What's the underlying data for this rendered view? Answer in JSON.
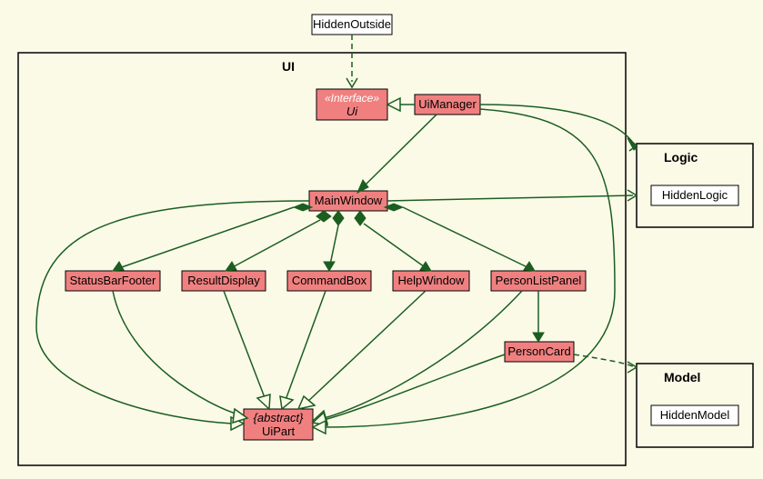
{
  "packages": {
    "ui": {
      "label": "UI"
    },
    "logic": {
      "label": "Logic"
    },
    "model": {
      "label": "Model"
    }
  },
  "nodes": {
    "hiddenOutside": {
      "label": "HiddenOutside"
    },
    "ui_iface": {
      "stereotype": "«Interface»",
      "name": "Ui"
    },
    "uiManager": {
      "label": "UiManager"
    },
    "mainWindow": {
      "label": "MainWindow"
    },
    "statusBarFooter": {
      "label": "StatusBarFooter"
    },
    "resultDisplay": {
      "label": "ResultDisplay"
    },
    "commandBox": {
      "label": "CommandBox"
    },
    "helpWindow": {
      "label": "HelpWindow"
    },
    "personListPanel": {
      "label": "PersonListPanel"
    },
    "personCard": {
      "label": "PersonCard"
    },
    "uiPart": {
      "stereotype": "{abstract}",
      "name": "UiPart"
    },
    "hiddenLogic": {
      "label": "HiddenLogic"
    },
    "hiddenModel": {
      "label": "HiddenModel"
    }
  },
  "relations": [
    {
      "from": "HiddenOutside",
      "to": "Ui",
      "type": "dependency"
    },
    {
      "from": "UiManager",
      "to": "Ui",
      "type": "realization"
    },
    {
      "from": "UiManager",
      "to": "MainWindow",
      "type": "association"
    },
    {
      "from": "UiManager",
      "to": "Logic",
      "type": "association"
    },
    {
      "from": "MainWindow",
      "to": "Logic",
      "type": "association"
    },
    {
      "from": "MainWindow",
      "to": "StatusBarFooter",
      "type": "composition"
    },
    {
      "from": "MainWindow",
      "to": "ResultDisplay",
      "type": "composition"
    },
    {
      "from": "MainWindow",
      "to": "CommandBox",
      "type": "composition"
    },
    {
      "from": "MainWindow",
      "to": "HelpWindow",
      "type": "composition"
    },
    {
      "from": "MainWindow",
      "to": "PersonListPanel",
      "type": "composition"
    },
    {
      "from": "PersonListPanel",
      "to": "PersonCard",
      "type": "association"
    },
    {
      "from": "PersonCard",
      "to": "Model",
      "type": "dependency"
    },
    {
      "from": "MainWindow",
      "to": "UiPart",
      "type": "generalization"
    },
    {
      "from": "StatusBarFooter",
      "to": "UiPart",
      "type": "generalization"
    },
    {
      "from": "ResultDisplay",
      "to": "UiPart",
      "type": "generalization"
    },
    {
      "from": "CommandBox",
      "to": "UiPart",
      "type": "generalization"
    },
    {
      "from": "HelpWindow",
      "to": "UiPart",
      "type": "generalization"
    },
    {
      "from": "PersonListPanel",
      "to": "UiPart",
      "type": "generalization"
    },
    {
      "from": "PersonCard",
      "to": "UiPart",
      "type": "generalization"
    },
    {
      "from": "UiManager",
      "to": "UiPart",
      "type": "generalization"
    }
  ],
  "colors": {
    "background": "#FBFAE7",
    "classFill": "#F08080",
    "edge": "#1B5E20"
  }
}
